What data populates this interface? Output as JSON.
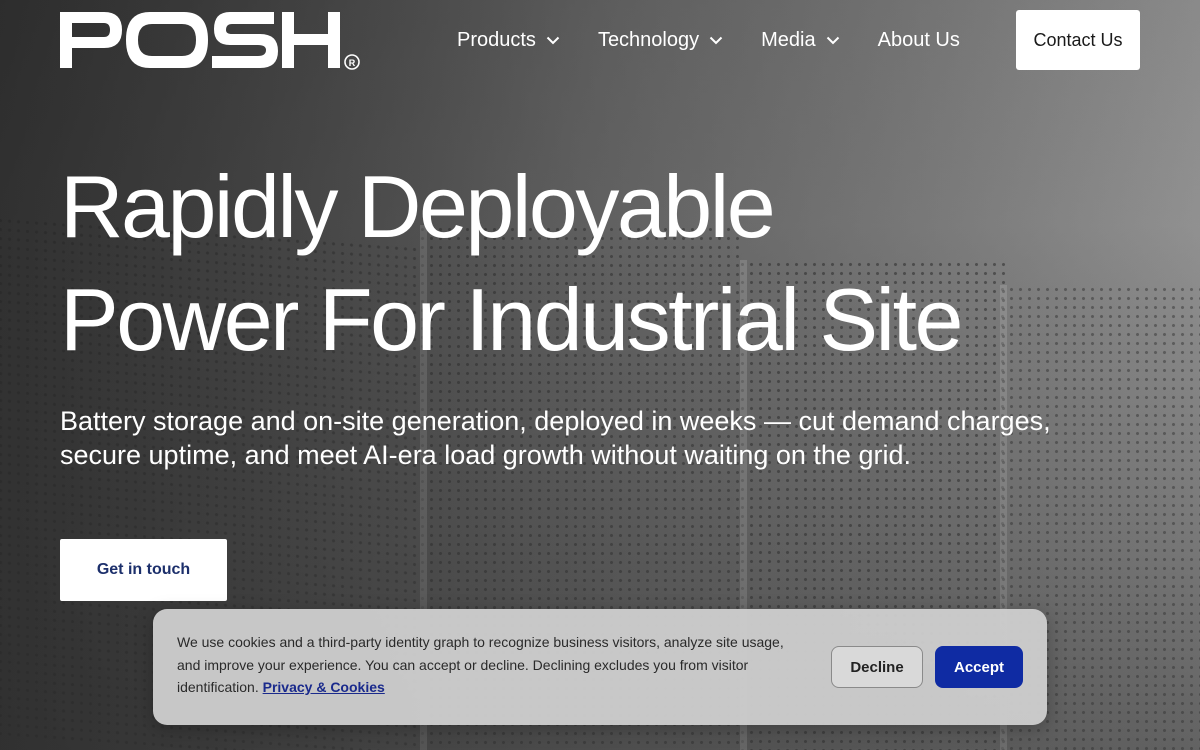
{
  "brand": {
    "logo_text": "POSH",
    "registered_mark": "®"
  },
  "nav": {
    "items": [
      {
        "label": "Products",
        "has_dropdown": true
      },
      {
        "label": "Technology",
        "has_dropdown": true
      },
      {
        "label": "Media",
        "has_dropdown": true
      },
      {
        "label": "About Us",
        "has_dropdown": false
      }
    ],
    "contact_label": "Contact Us"
  },
  "hero": {
    "title_lines": [
      "Rapidly Deployable",
      "Power For Industrial Site"
    ],
    "subtitle_lines": [
      "Battery storage and on-site generation, deployed in weeks — cut demand charges,",
      "secure uptime, and meet AI-era load growth without waiting on the grid."
    ],
    "cta_label": "Get in touch"
  },
  "cookie_banner": {
    "text_lines": [
      "We use cookies and a third-party identity graph to recognize business visitors, analyze site usage,",
      "and improve your experience. You can accept or decline. Declining excludes you from visitor",
      "identification."
    ],
    "link_label": "Privacy & Cookies",
    "decline_label": "Decline",
    "accept_label": "Accept"
  },
  "colors": {
    "accept": "#0f2ba3",
    "cta_text": "#1c2f6b",
    "link": "#1a2a8c"
  },
  "icons": {
    "dropdown": "chevron-down-icon"
  }
}
